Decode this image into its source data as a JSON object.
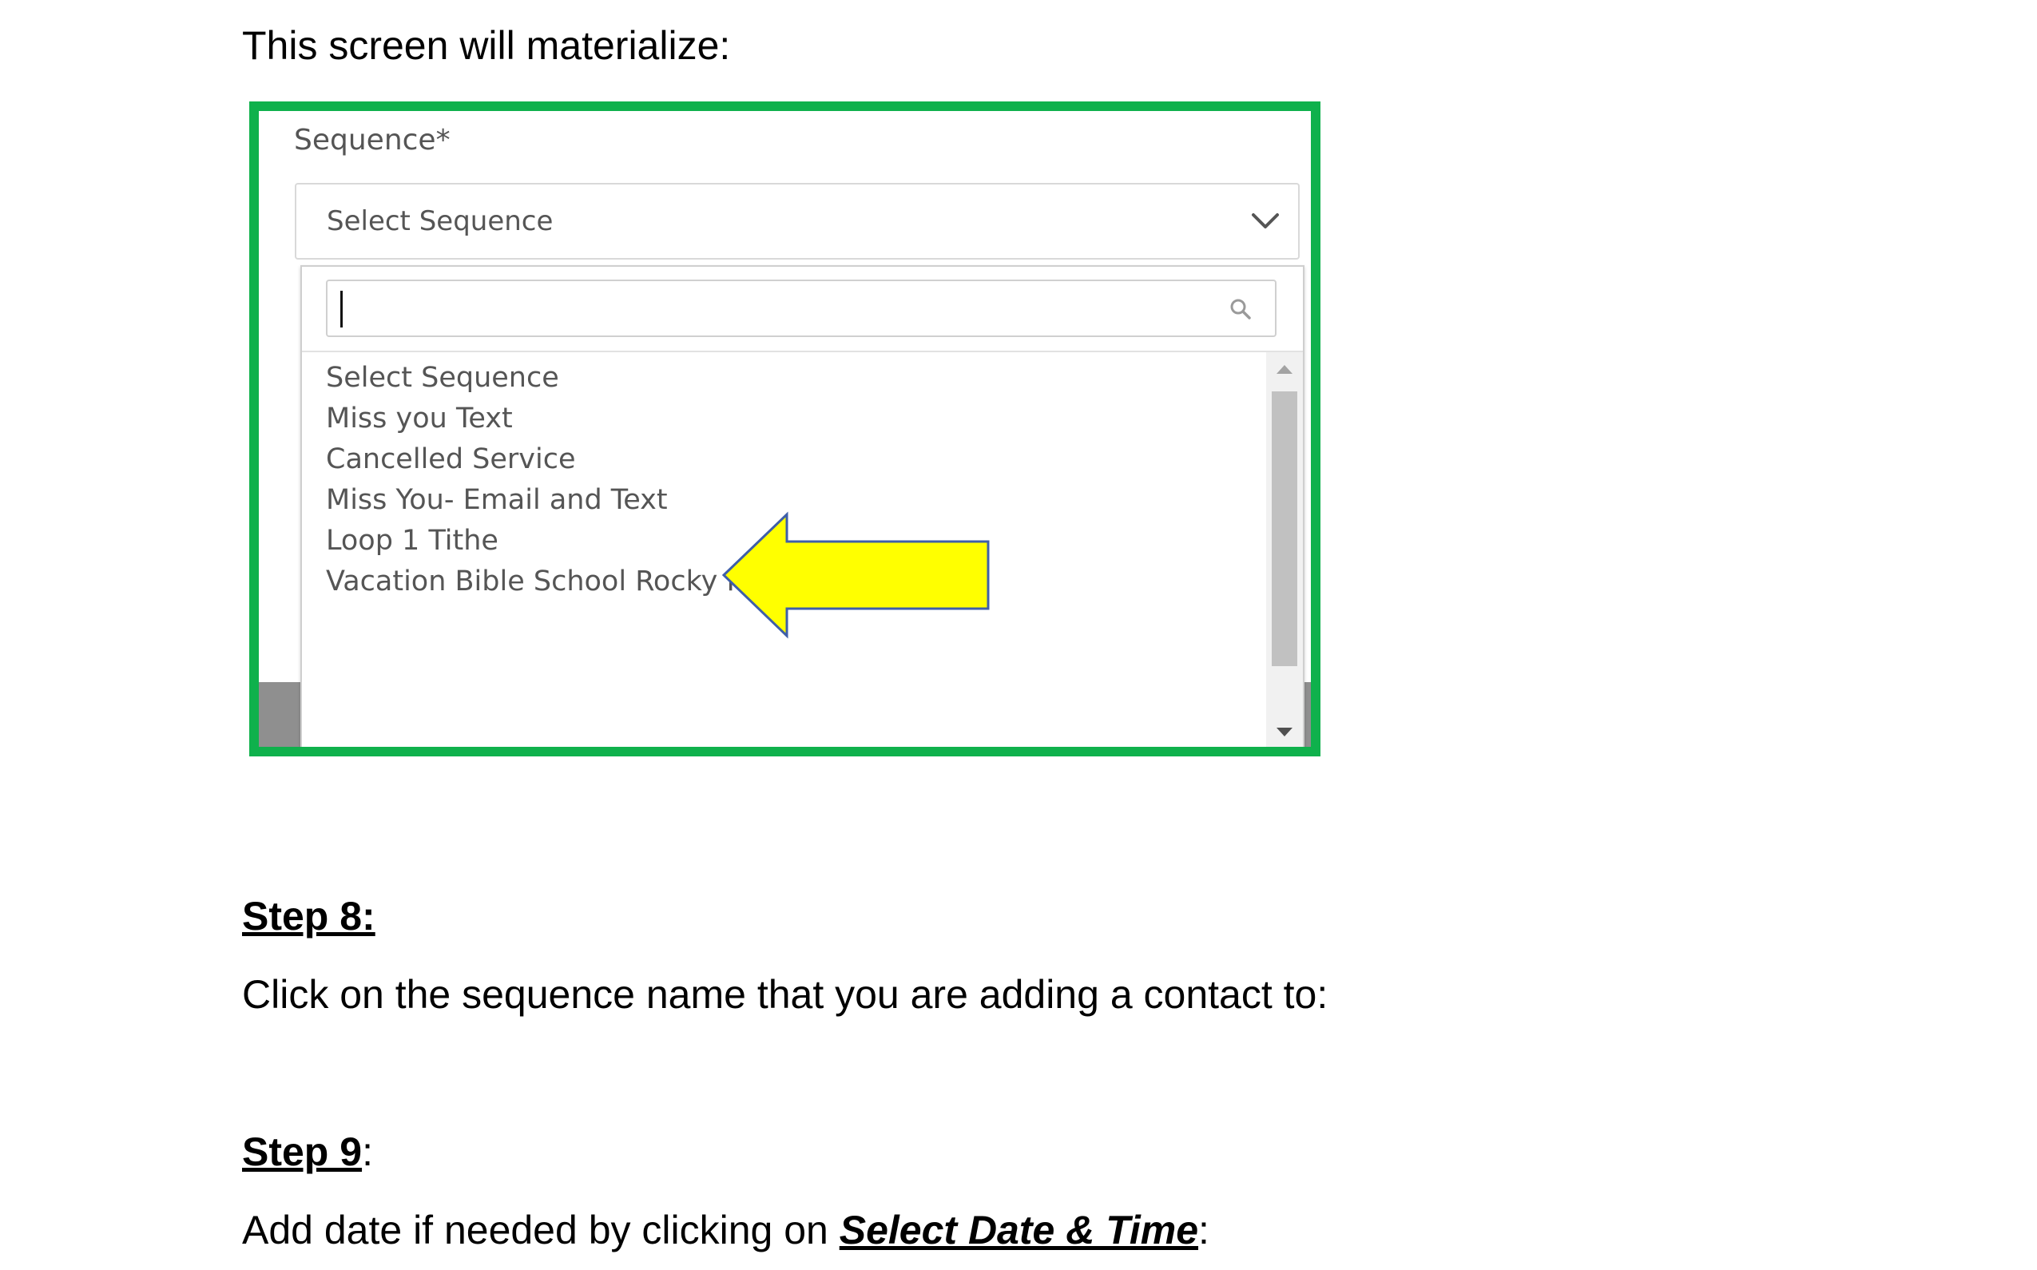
{
  "intro_text": "This screen will materialize:",
  "screenshot": {
    "field_label": "Sequence*",
    "select_value": "Select Sequence",
    "search": {
      "value": ""
    },
    "options": [
      "Select Sequence",
      "Miss you Text",
      "Cancelled Service",
      "Miss You- Email and Text",
      "Loop 1 Tithe",
      "Vacation Bible School Rocky Railway"
    ],
    "icons": [
      "chevron-down-icon",
      "search-icon",
      "arrow-left-icon"
    ],
    "colors": {
      "frame_border": "#0fb14c",
      "arrow_fill": "#ffff00",
      "arrow_stroke": "#3f5fa8"
    }
  },
  "step8": {
    "heading": "Step 8:",
    "text": "Click on the sequence name that you are adding a contact to:"
  },
  "step9": {
    "heading": "Step 9",
    "heading_suffix": ":",
    "text_before": "Add date if needed by clicking on ",
    "emphasis": "Select Date & Time",
    "text_after": ":"
  }
}
